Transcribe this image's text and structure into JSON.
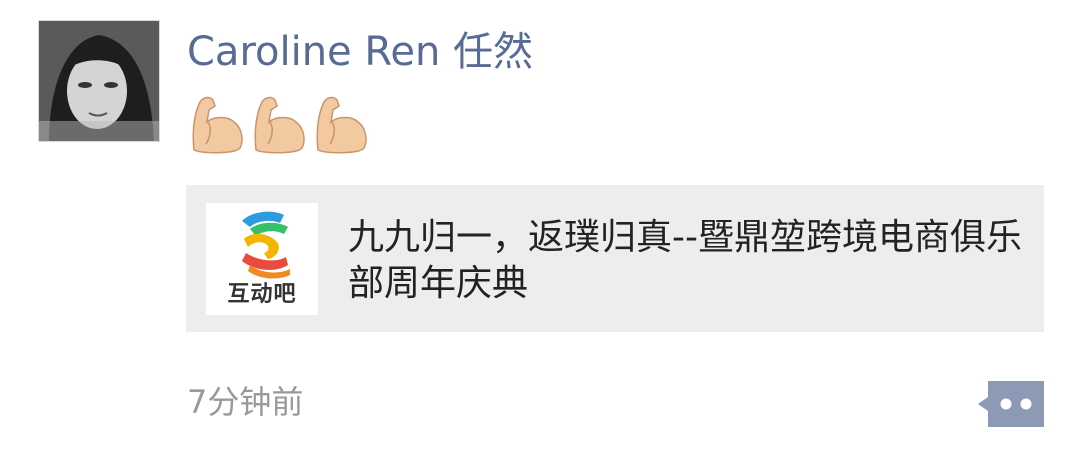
{
  "post": {
    "author": "Caroline Ren 任然",
    "emojis": [
      "flexed-biceps",
      "flexed-biceps",
      "flexed-biceps"
    ],
    "share_card": {
      "source_label": "互动吧",
      "title": "九九归一，返璞归真--暨鼎堃跨境电商俱乐部周年庆典"
    },
    "timestamp": "7分钟前"
  },
  "colors": {
    "author_name": "#576b95",
    "card_background": "#ededed",
    "timestamp": "#999999",
    "more_button": "#8c9ab6"
  }
}
